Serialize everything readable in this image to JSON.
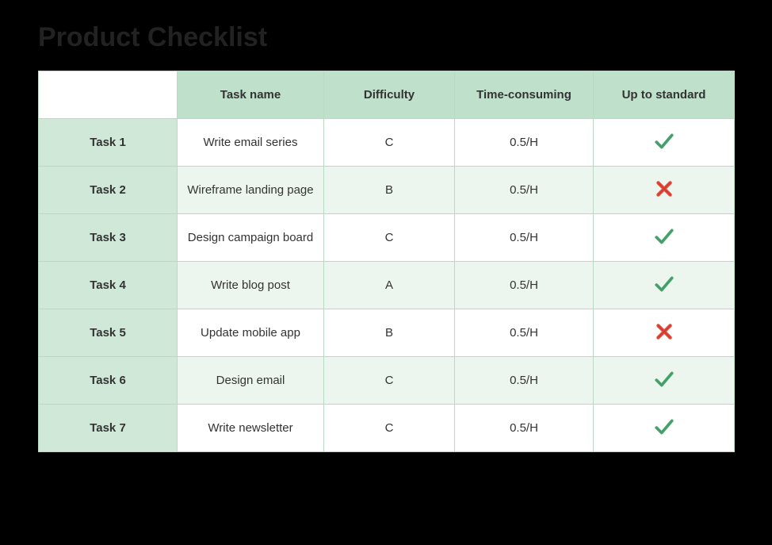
{
  "title": "Product Checklist",
  "headers": {
    "task_name": "Task name",
    "difficulty": "Difficulty",
    "time": "Time-consuming",
    "standard": "Up to standard"
  },
  "rows": [
    {
      "label": "Task 1",
      "name": "Write email series",
      "difficulty": "C",
      "time": "0.5/H",
      "status": "check"
    },
    {
      "label": "Task 2",
      "name": "Wireframe landing page",
      "difficulty": "B",
      "time": "0.5/H",
      "status": "cross"
    },
    {
      "label": "Task 3",
      "name": "Design campaign board",
      "difficulty": "C",
      "time": "0.5/H",
      "status": "check"
    },
    {
      "label": "Task 4",
      "name": "Write blog post",
      "difficulty": "A",
      "time": "0.5/H",
      "status": "check"
    },
    {
      "label": "Task 5",
      "name": "Update mobile app",
      "difficulty": "B",
      "time": "0.5/H",
      "status": "cross"
    },
    {
      "label": "Task 6",
      "name": "Design email",
      "difficulty": "C",
      "time": "0.5/H",
      "status": "check"
    },
    {
      "label": "Task 7",
      "name": "Write newsletter",
      "difficulty": "C",
      "time": "0.5/H",
      "status": "check"
    }
  ],
  "icons": {
    "check": "check-icon",
    "cross": "cross-icon"
  },
  "colors": {
    "header_bg": "#bfe1cb",
    "rowhead_bg": "#cfe8d7",
    "alt_bg": "#edf6ee",
    "border": "#b9d9c5",
    "check": "#4aa86f",
    "cross": "#e24a3b"
  }
}
